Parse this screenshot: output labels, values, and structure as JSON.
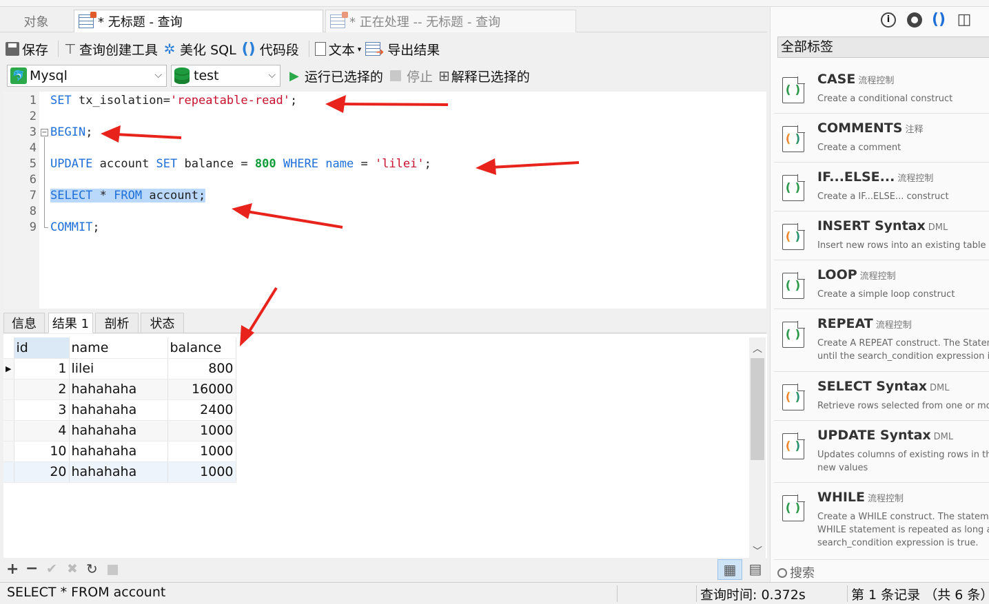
{
  "tabs": {
    "objects": "对象",
    "query": "* 无标题 - 查询",
    "processing": "* 正在处理 -- 无标题 - 查询"
  },
  "toolbar": {
    "save": "保存",
    "query_builder": "查询创建工具",
    "beautify": "美化 SQL",
    "snippet": "代码段",
    "text": "文本",
    "export": "导出结果"
  },
  "toolbar2": {
    "connection": "Mysql",
    "database": "test",
    "run_selected": "运行已选择的",
    "stop": "停止",
    "explain_selected": "解释已选择的"
  },
  "editor": {
    "line_numbers": [
      "1",
      "2",
      "3",
      "4",
      "5",
      "6",
      "7",
      "8",
      "9"
    ]
  },
  "result_tabs": [
    "信息",
    "结果 1",
    "剖析",
    "状态"
  ],
  "result": {
    "columns": [
      "id",
      "name",
      "balance"
    ],
    "rows": [
      [
        "1",
        "lilei",
        "800"
      ],
      [
        "2",
        "hahahaha",
        "16000"
      ],
      [
        "3",
        "hahahaha",
        "2400"
      ],
      [
        "4",
        "hahahaha",
        "1000"
      ],
      [
        "10",
        "hahahaha",
        "1000"
      ],
      [
        "20",
        "hahahaha",
        "1000"
      ]
    ]
  },
  "statusbar": {
    "sql": "SELECT * FROM account",
    "query_time": "查询时间: 0.372s",
    "record_info": "第 1 条记录 （共 6 条）"
  },
  "right_panel": {
    "filter": "全部标签",
    "search_placeholder": "搜索",
    "snippets": [
      {
        "title": "CASE",
        "tag": "流程控制",
        "desc": [
          "Create a conditional construct"
        ]
      },
      {
        "title": "COMMENTS",
        "tag": "注释",
        "desc": [
          "Create a comment"
        ]
      },
      {
        "title": "IF...ELSE...",
        "tag": "流程控制",
        "desc": [
          "Create a IF...ELSE... construct"
        ]
      },
      {
        "title": "INSERT Syntax",
        "tag": "DML",
        "desc": [
          "Insert new rows into an existing table"
        ]
      },
      {
        "title": "LOOP",
        "tag": "流程控制",
        "desc": [
          "Create a simple loop construct"
        ]
      },
      {
        "title": "REPEAT",
        "tag": "流程控制",
        "desc": [
          "Create A REPEAT construct. The Stateme",
          "until the search_condition expression is t"
        ]
      },
      {
        "title": "SELECT Syntax",
        "tag": "DML",
        "desc": [
          "Retrieve rows selected from one or more"
        ]
      },
      {
        "title": "UPDATE Syntax",
        "tag": "DML",
        "desc": [
          "Updates columns of existing rows in the",
          "new values"
        ]
      },
      {
        "title": "WHILE",
        "tag": "流程控制",
        "desc": [
          "Create a WHILE construct. The statemen",
          "WHILE statement is repeated as long as t",
          "search_condition expression is true."
        ]
      }
    ]
  },
  "colors": {
    "keyword": "#1e6fd8",
    "string": "#c8102e",
    "number": "#0f9d3a",
    "selection": "#b9d8fb",
    "annotation_arrow": "#e8231b"
  }
}
